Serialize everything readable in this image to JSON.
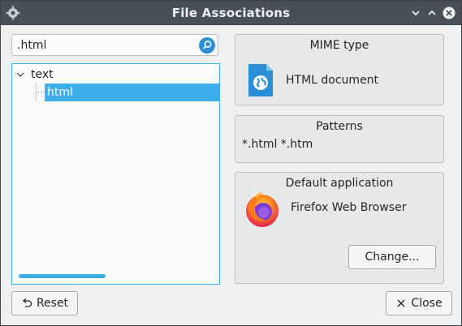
{
  "window": {
    "title": "File Associations"
  },
  "search": {
    "value": ".html",
    "icon": "search-icon"
  },
  "tree": {
    "items": [
      {
        "label": "text",
        "expanded": true
      },
      {
        "label": "html",
        "selected": true
      }
    ]
  },
  "mime": {
    "heading": "MIME type",
    "label": "HTML document",
    "icon": "html-document-icon"
  },
  "patterns": {
    "heading": "Patterns",
    "value": "*.html *.htm"
  },
  "default_app": {
    "heading": "Default application",
    "name": "Firefox Web Browser",
    "icon": "firefox-icon",
    "change_label": "Change..."
  },
  "buttons": {
    "reset_label": "Reset",
    "close_label": "Close"
  },
  "colors": {
    "accent": "#3daee9",
    "titlebar": "#475057",
    "background": "#eff0f1"
  }
}
